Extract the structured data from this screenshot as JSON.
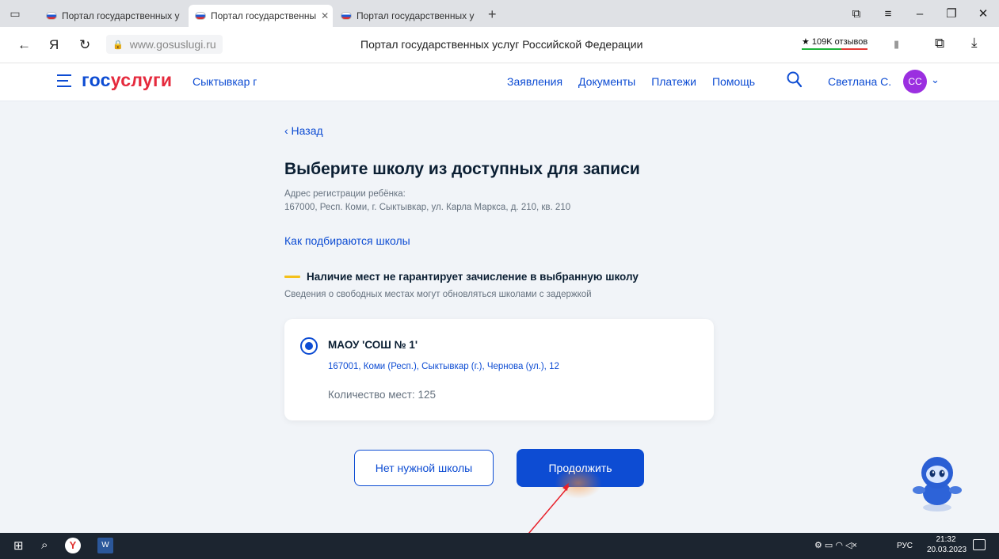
{
  "browser": {
    "tabs": [
      {
        "title": "Портал государственных у",
        "active": false
      },
      {
        "title": "Портал государственны",
        "active": true
      },
      {
        "title": "Портал государственных у",
        "active": false
      }
    ],
    "new_tab": "+",
    "url": "www.gosuslugi.ru",
    "page_title": "Портал государственных услуг Российской Федерации",
    "reviews_badge": "★ 109K отзывов",
    "yandex_letter": "Я"
  },
  "header": {
    "logo_part1": "гос",
    "logo_part2": "услуги",
    "city": "Сыктывкар г",
    "nav": [
      "Заявления",
      "Документы",
      "Платежи",
      "Помощь"
    ],
    "user_name": "Светлана С.",
    "avatar_initials": "СС"
  },
  "main": {
    "back_label": "‹ Назад",
    "heading": "Выберите школу из доступных для записи",
    "address_label": "Адрес регистрации ребёнка:",
    "address_value": "167000, Респ. Коми, г. Сыктывкар, ул. Карла Маркса, д. 210, кв. 210",
    "how_link": "Как подбираются школы",
    "warning_title": "Наличие мест не гарантирует зачисление в выбранную школу",
    "warning_sub": "Сведения о свободных местах могут обновляться школами с задержкой",
    "school": {
      "name": "МАОУ 'СОШ № 1'",
      "address": "167001, Коми (Респ.), Сыктывкар (г.), Чернова (ул.), 12",
      "seats": "Количество мест: 125",
      "selected": true
    },
    "btn_no_school": "Нет нужной школы",
    "btn_continue": "Продолжить"
  },
  "taskbar": {
    "lang": "РУС",
    "time": "21:32",
    "date": "20.03.2023"
  },
  "colors": {
    "accent": "#0d4cd3",
    "logo_red": "#e52a3d",
    "warning_yellow": "#f4c01b",
    "avatar": "#9b2fe0"
  }
}
